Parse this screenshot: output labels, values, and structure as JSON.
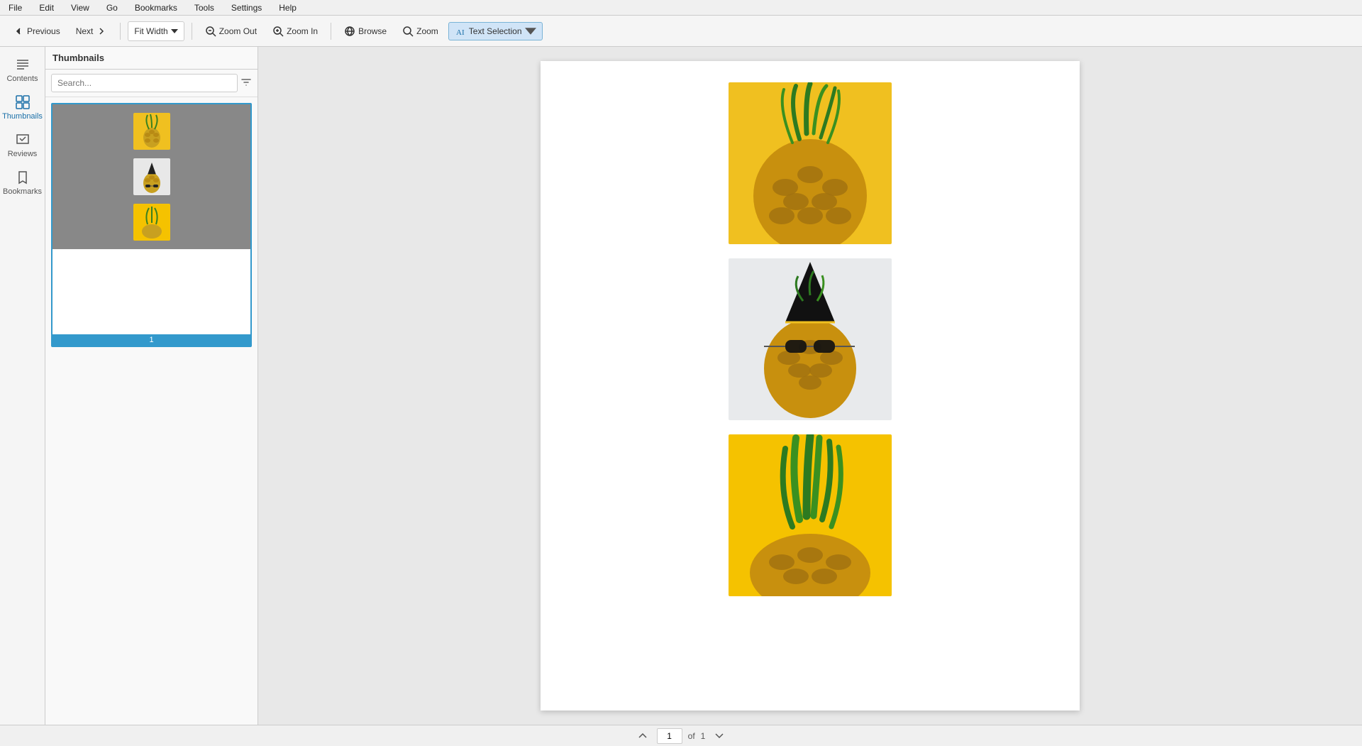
{
  "menu": {
    "items": [
      "File",
      "Edit",
      "View",
      "Go",
      "Bookmarks",
      "Tools",
      "Settings",
      "Help"
    ]
  },
  "toolbar": {
    "previous_label": "Previous",
    "next_label": "Next",
    "fit_width_label": "Fit Width",
    "zoom_out_label": "Zoom Out",
    "zoom_in_label": "Zoom In",
    "browse_label": "Browse",
    "zoom_label": "Zoom",
    "text_selection_label": "Text Selection"
  },
  "sidebar": {
    "items": [
      {
        "id": "contents",
        "label": "Contents"
      },
      {
        "id": "thumbnails",
        "label": "Thumbnails"
      },
      {
        "id": "reviews",
        "label": "Reviews"
      },
      {
        "id": "bookmarks",
        "label": "Bookmarks"
      }
    ]
  },
  "thumbnails_panel": {
    "title": "Thumbnails",
    "search_placeholder": "Search...",
    "page_number": "1"
  },
  "main_content": {
    "page_number": "1",
    "page_total": "1",
    "of_label": "of"
  },
  "pineapple_images": [
    {
      "id": "img1",
      "bg": "#f0c020",
      "desc": "Pineapple on yellow background"
    },
    {
      "id": "img2",
      "bg": "#e8e8e8",
      "desc": "Pineapple with sunglasses party hat"
    },
    {
      "id": "img3",
      "bg": "#f5c200",
      "desc": "Pineapple on yellow background bottom"
    }
  ]
}
